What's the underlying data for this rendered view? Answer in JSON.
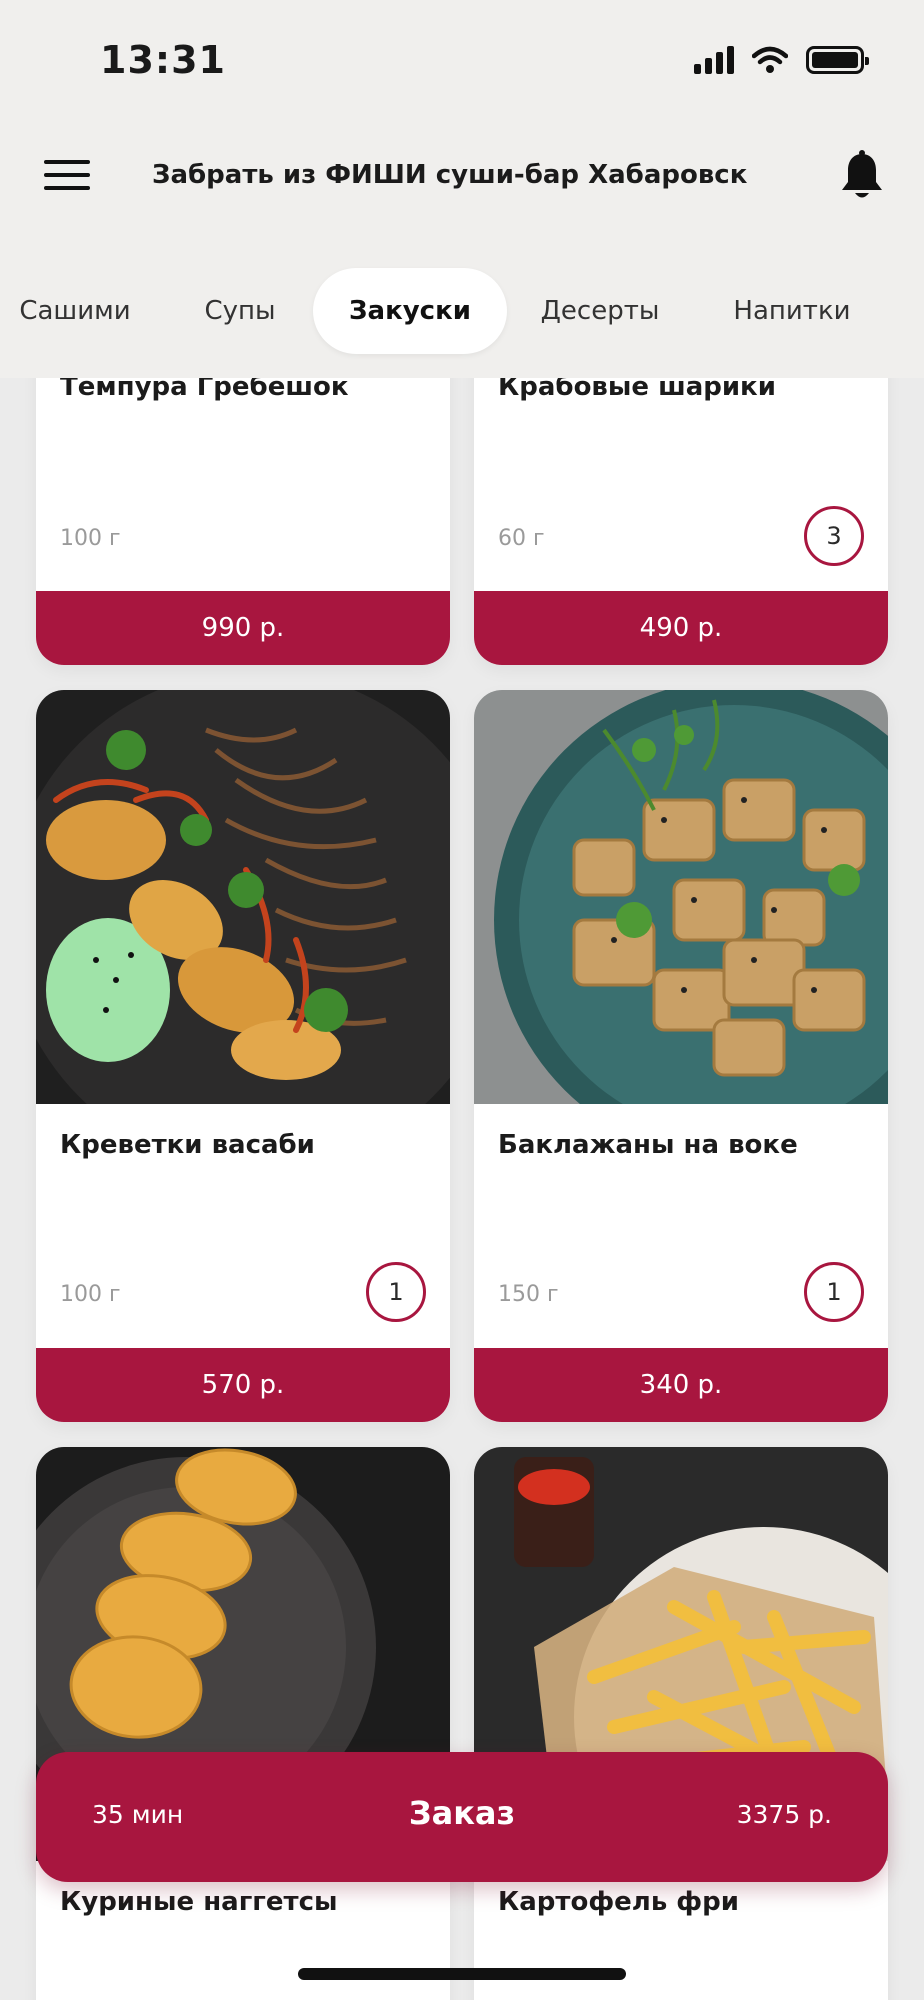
{
  "status_bar": {
    "time": "13:31"
  },
  "header": {
    "title": "Забрать из ФИШИ суши-бар Хабаровск"
  },
  "tabs": [
    {
      "label": "Сашими"
    },
    {
      "label": "Супы"
    },
    {
      "label": "Закуски",
      "active": true
    },
    {
      "label": "Десерты"
    },
    {
      "label": "Напитки"
    }
  ],
  "products": [
    {
      "name": "Темпура Гребешок",
      "weight": "100 г",
      "price": "990 р."
    },
    {
      "name": "Крабовые шарики",
      "weight": "60 г",
      "price": "490 р.",
      "qty": "3"
    },
    {
      "name": "Креветки васаби",
      "weight": "100 г",
      "price": "570 р.",
      "qty": "1"
    },
    {
      "name": "Баклажаны на воке",
      "weight": "150 г",
      "price": "340 р.",
      "qty": "1"
    },
    {
      "name": "Куриные наггетсы"
    },
    {
      "name": "Картофель фри"
    }
  ],
  "order": {
    "time": "35 мин",
    "label": "Заказ",
    "total": "3375 р."
  },
  "colors": {
    "accent": "#a8163f",
    "header_bg": "#f0efed",
    "page_bg": "#ebebeb"
  }
}
